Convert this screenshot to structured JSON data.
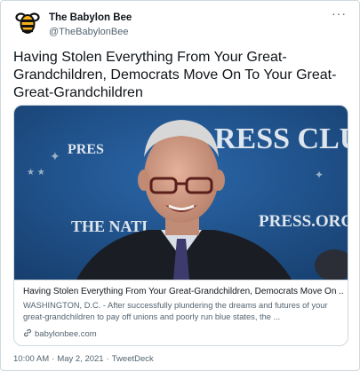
{
  "account": {
    "name": "The Babylon Bee",
    "handle": "@TheBabylonBee",
    "avatar_icon": "bee-icon"
  },
  "tweet": {
    "text": "Having Stolen Everything From Your Great-Grandchildren, Democrats Move On To Your Great-Great-Grandchildren",
    "more_icon": "ellipsis-icon"
  },
  "card": {
    "image_sign_text": {
      "top": "RESS CLU",
      "top_left": "PRES",
      "bottom_left": "THE NATI",
      "bottom_right": "PRESS.ORG"
    },
    "title": "Having Stolen Everything From Your Great-Grandchildren, Democrats Move On ...",
    "description": "WASHINGTON, D.C. - After successfully plundering the dreams and futures of your great-grandchildren to pay off unions and poorly run blue states, the ...",
    "domain": "babylonbee.com"
  },
  "meta": {
    "time": "10:00 AM",
    "date": "May 2, 2021",
    "source": "TweetDeck",
    "separator": "·"
  },
  "colors": {
    "border": "#cfd9de",
    "secondary_text": "#536471",
    "image_bg": "#1d4f8a"
  }
}
